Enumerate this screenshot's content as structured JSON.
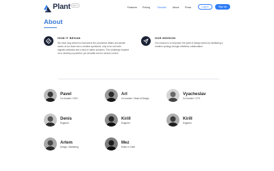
{
  "header": {
    "logo_text": "Plant",
    "logo_badge": "BETA",
    "nav": [
      "Features",
      "Pricing",
      "Tutorials",
      "About",
      "Press"
    ],
    "active_nav": "Tutorials",
    "login_label": "Log In",
    "signup_label": "Sign Up",
    "accent_color": "#2e7cf6"
  },
  "about": {
    "title": "About",
    "how_heading": "HOW IT BEGAN",
    "how_text": "We have long strived to harmonize the productive affairs and artistic minds of our team into a creative symbiosis, only to be met with logistics setbacks and a lack of viable solutions. This challenge inspired us to develop a powerful, yet versatile tool for service control.",
    "mission_heading": "OUR MISSION",
    "mission_text": "Our mission is to empower the spirit of design teams by facilitating a creative synergy through effortless collaboration.",
    "how_icon": "diamond-logo-icon",
    "mission_icon": "paper-plane-icon"
  },
  "team": [
    {
      "name": "Pavel",
      "role": "Co-founder / CEO"
    },
    {
      "name": "Art",
      "role": "Co-founder / Head of Design"
    },
    {
      "name": "Vyacheslav",
      "role": "Co-founder / CTO"
    },
    {
      "name": "Denis",
      "role": "Engineer"
    },
    {
      "name": "Kirill",
      "role": "Engineer"
    },
    {
      "name": "Kirill",
      "role": "Engineer"
    },
    {
      "name": "Artem",
      "role": "Design / Marketing"
    },
    {
      "name": "Mez",
      "role": "Editor in Chief"
    }
  ]
}
